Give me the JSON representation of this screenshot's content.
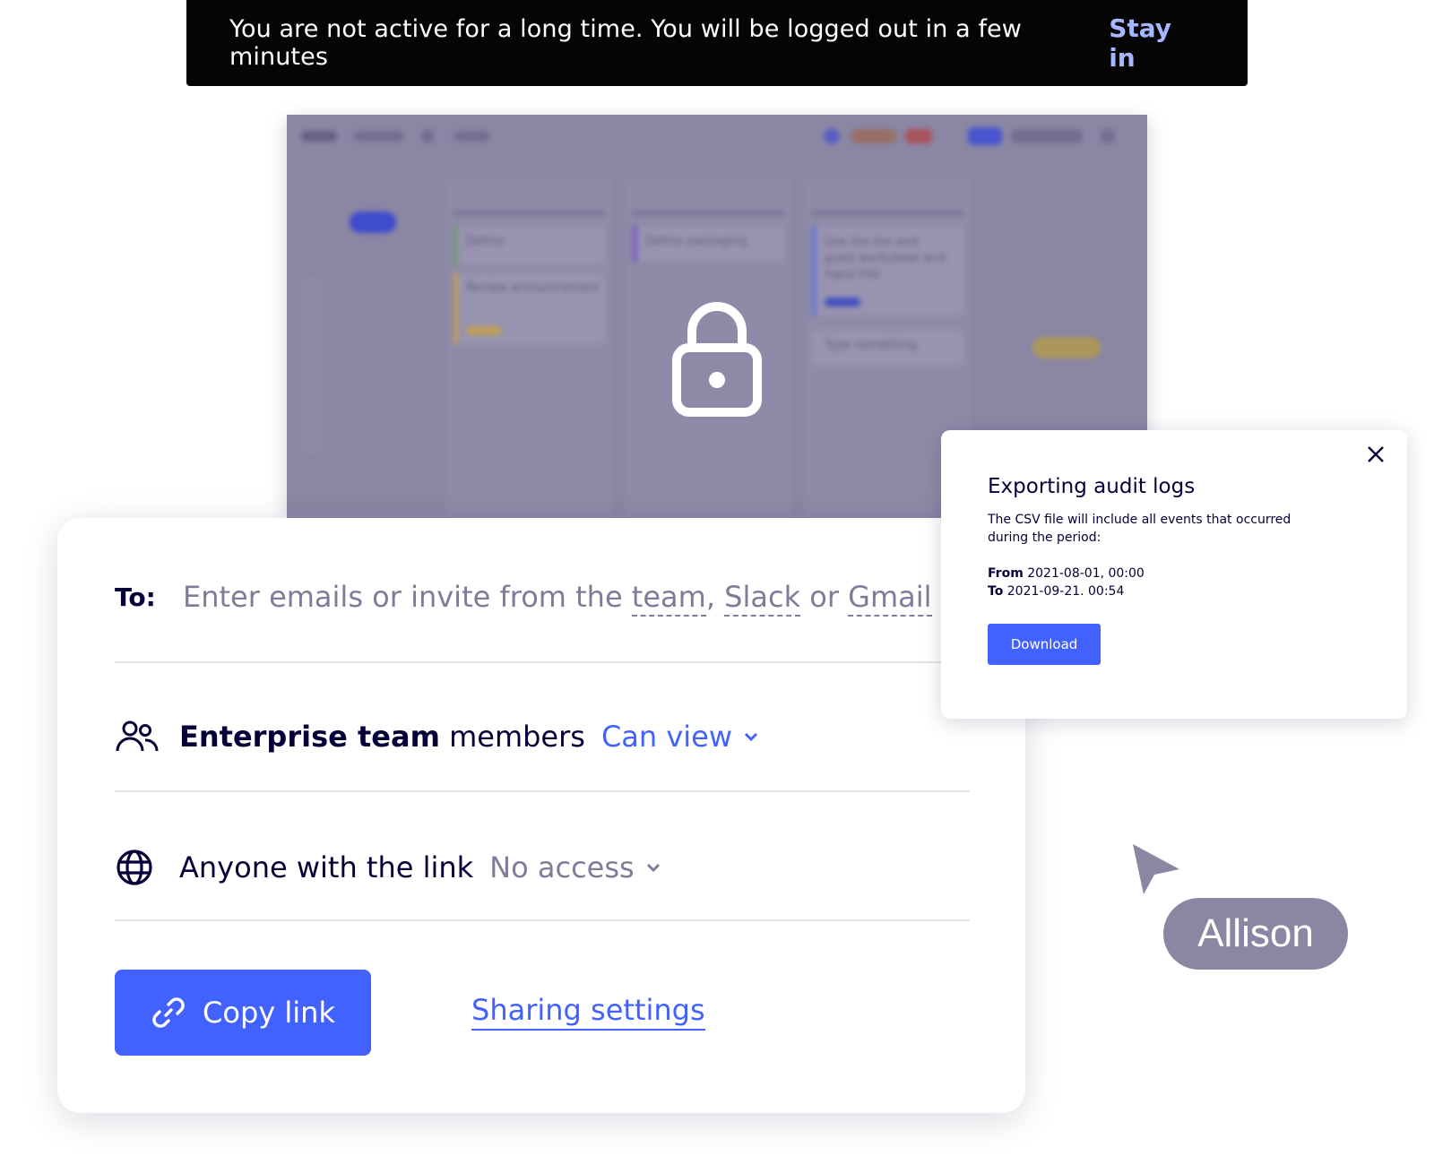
{
  "toast": {
    "message": "You are not active for a long time. You will be logged out in a few minutes",
    "action": "Stay in"
  },
  "board": {
    "columns": [
      {
        "cards": [
          "Define",
          "Review announcement"
        ]
      },
      {
        "cards": [
          "Define packaging"
        ]
      },
      {
        "cards": [
          "Use the tier and goals worksheet and input into",
          "Type something"
        ]
      }
    ],
    "lock_icon": "lock-icon"
  },
  "share": {
    "to_label": "To:",
    "to_placeholder_prefix": "Enter emails or invite from the ",
    "to_team": "team",
    "to_sep1": ", ",
    "to_slack": "Slack",
    "to_sep2": " or ",
    "to_gmail": "Gmail",
    "team_name": "Enterprise team",
    "team_suffix": " members",
    "team_permission": "Can view",
    "link_label": "Anyone with the link",
    "link_permission": "No access",
    "copy_button": "Copy link",
    "settings_link": "Sharing settings",
    "accent": "#4262ff"
  },
  "export": {
    "title": "Exporting audit logs",
    "description": "The CSV file will include all events that occurred during the period:",
    "from_label": "From",
    "from_value": "2021-08-01, 00:00",
    "to_label": "To",
    "to_value": "2021-09-21. 00:54",
    "download": "Download"
  },
  "cursor": {
    "name": "Allison"
  }
}
